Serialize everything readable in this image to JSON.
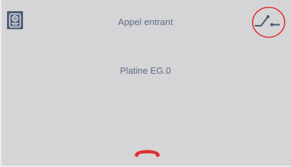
{
  "header": {
    "title": "Appel entrant",
    "left_icon": "intercom-panel-icon",
    "right_icon": "door-opener-switch-icon",
    "right_highlight_color": "#e0302e"
  },
  "main": {
    "station_name": "Platine EG.0"
  },
  "footer": {
    "hangup_icon": "hang-up-phone-icon",
    "hangup_color": "#e0302e"
  },
  "colors": {
    "background": "#d5d5d7",
    "text": "#5d6a86",
    "icon_dark": "#4f5d77"
  }
}
